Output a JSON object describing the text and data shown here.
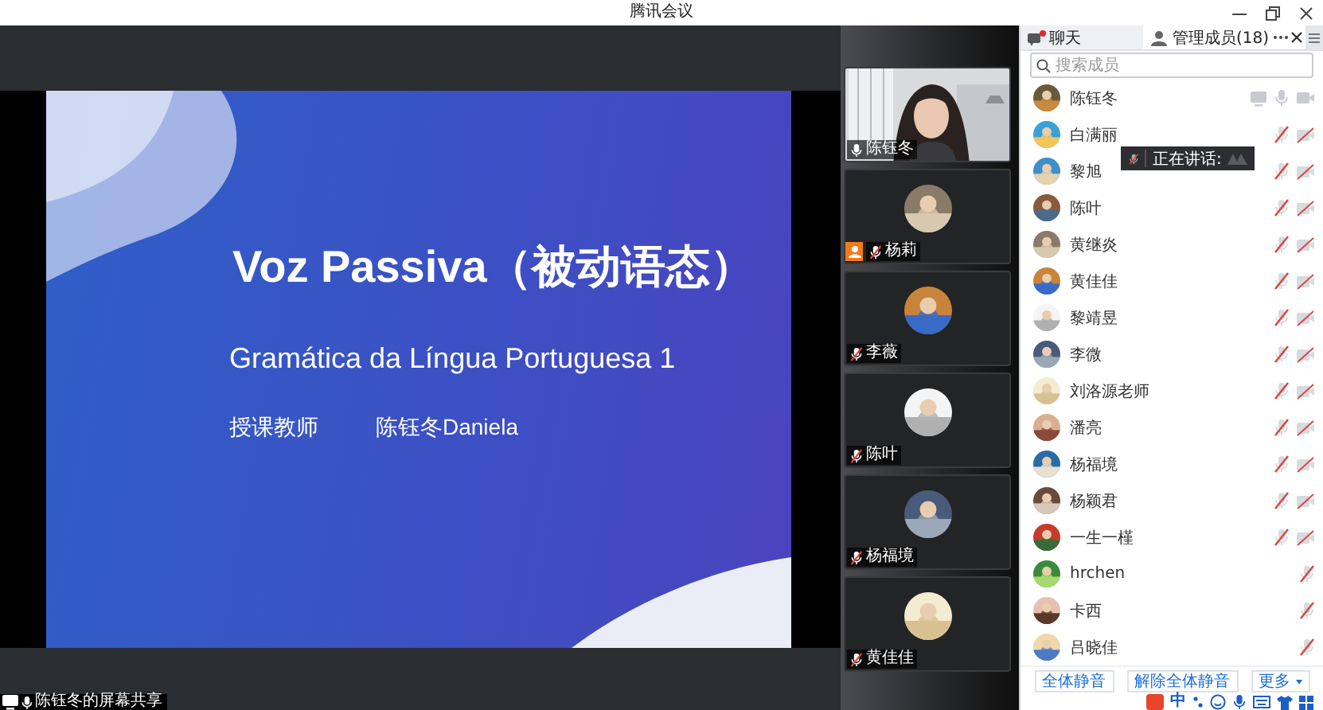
{
  "window": {
    "title": "腾讯会议"
  },
  "slide": {
    "title": "Voz Passiva（被动语态）",
    "subtitle": "Gramática da Língua Portuguesa 1",
    "teacher_label": "授课教师",
    "teacher_name": "陈钰冬Daniela"
  },
  "video_tiles": [
    {
      "name": "陈钰冬",
      "kind": "video",
      "mic_muted": false,
      "host": false
    },
    {
      "name": "杨莉",
      "kind": "avatar",
      "mic_muted": true,
      "host": true
    },
    {
      "name": "李薇",
      "kind": "avatar",
      "mic_muted": true,
      "host": false
    },
    {
      "name": "陈叶",
      "kind": "avatar",
      "mic_muted": true,
      "host": false
    },
    {
      "name": "杨福境",
      "kind": "avatar",
      "mic_muted": true,
      "host": false
    },
    {
      "name": "黄佳佳",
      "kind": "avatar",
      "mic_muted": true,
      "host": false
    }
  ],
  "share_status": "陈钰冬的屏幕共享",
  "panel": {
    "tabs": [
      {
        "label": "聊天",
        "selected": false,
        "unread": true
      },
      {
        "label": "管理成员(18)",
        "selected": true,
        "unread": false
      }
    ],
    "search": {
      "placeholder": "搜索成员"
    },
    "members": [
      {
        "name": "陈钰冬",
        "sharing": true,
        "mic_muted": false,
        "camera_shown": true,
        "camera_muted": false
      },
      {
        "name": "白满丽",
        "sharing": false,
        "mic_muted": true,
        "camera_shown": true,
        "camera_muted": true
      },
      {
        "name": "黎旭",
        "sharing": false,
        "mic_muted": true,
        "camera_shown": true,
        "camera_muted": true
      },
      {
        "name": "陈叶",
        "sharing": false,
        "mic_muted": true,
        "camera_shown": true,
        "camera_muted": true
      },
      {
        "name": "黄继炎",
        "sharing": false,
        "mic_muted": true,
        "camera_shown": true,
        "camera_muted": true
      },
      {
        "name": "黄佳佳",
        "sharing": false,
        "mic_muted": true,
        "camera_shown": true,
        "camera_muted": true
      },
      {
        "name": "黎靖昱",
        "sharing": false,
        "mic_muted": true,
        "camera_shown": true,
        "camera_muted": true
      },
      {
        "name": "李微",
        "sharing": false,
        "mic_muted": true,
        "camera_shown": true,
        "camera_muted": true
      },
      {
        "name": "刘洛源老师",
        "sharing": false,
        "mic_muted": true,
        "camera_shown": true,
        "camera_muted": true
      },
      {
        "name": "潘亮",
        "sharing": false,
        "mic_muted": true,
        "camera_shown": true,
        "camera_muted": true
      },
      {
        "name": "杨福境",
        "sharing": false,
        "mic_muted": true,
        "camera_shown": true,
        "camera_muted": true
      },
      {
        "name": "杨颖君",
        "sharing": false,
        "mic_muted": true,
        "camera_shown": true,
        "camera_muted": true
      },
      {
        "name": "一生一槿",
        "sharing": false,
        "mic_muted": true,
        "camera_shown": true,
        "camera_muted": true
      },
      {
        "name": "hrchen",
        "sharing": false,
        "mic_muted": true,
        "camera_shown": false
      },
      {
        "name": "卡西",
        "sharing": false,
        "mic_muted": true,
        "camera_shown": false
      },
      {
        "name": "吕晓佳",
        "sharing": false,
        "mic_muted": true,
        "camera_shown": false
      }
    ],
    "speaking_tooltip": "正在讲话:",
    "buttons": [
      {
        "label": "全体静音",
        "kind": "plain"
      },
      {
        "label": "解除全体静音",
        "kind": "plain"
      },
      {
        "label": "更多",
        "kind": "dropdown"
      }
    ]
  },
  "ime_bar": {
    "mode": "中"
  }
}
